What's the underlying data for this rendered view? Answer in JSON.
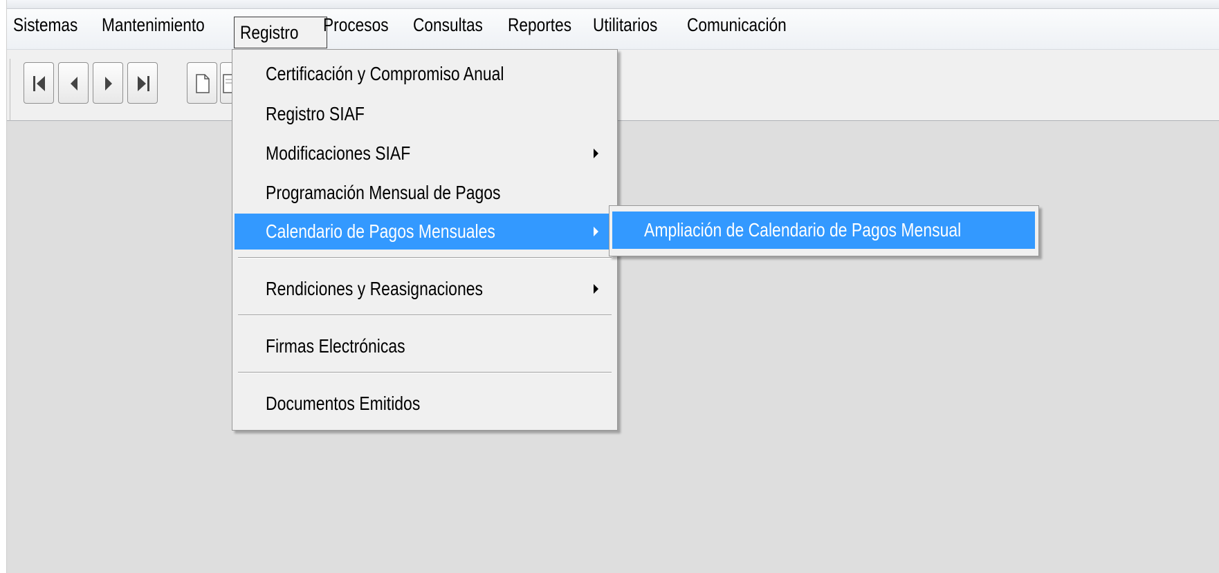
{
  "menubar": {
    "items": [
      {
        "label": "Sistemas"
      },
      {
        "label": "Mantenimiento"
      },
      {
        "label": "Registro"
      },
      {
        "label": "Procesos"
      },
      {
        "label": "Consultas"
      },
      {
        "label": "Reportes"
      },
      {
        "label": "Utilitarios"
      },
      {
        "label": "Comunicación"
      }
    ],
    "active": "Registro"
  },
  "toolbar": {
    "buttons": [
      {
        "icon": "first-record-icon"
      },
      {
        "icon": "previous-record-icon"
      },
      {
        "icon": "next-record-icon"
      },
      {
        "icon": "last-record-icon"
      },
      {
        "icon": "new-document-icon"
      },
      {
        "icon": "document-icon"
      }
    ]
  },
  "registro_menu": {
    "items": [
      {
        "label": "Certificación y Compromiso Anual",
        "submenu": false
      },
      {
        "label": "Registro SIAF",
        "submenu": false
      },
      {
        "label": "Modificaciones SIAF",
        "submenu": true
      },
      {
        "label": "Programación Mensual de Pagos",
        "submenu": false
      },
      {
        "label": "Calendario de Pagos Mensuales",
        "submenu": true,
        "highlighted": true
      },
      {
        "label": "Rendiciones y Reasignaciones",
        "submenu": true
      },
      {
        "label": "Firmas Electrónicas",
        "submenu": false
      },
      {
        "label": "Documentos Emitidos",
        "submenu": false
      }
    ]
  },
  "calendario_submenu": {
    "items": [
      {
        "label": "Ampliación de Calendario de Pagos Mensual",
        "highlighted": true
      }
    ]
  },
  "colors": {
    "highlight": "#3399ff",
    "menu_background": "#f0f0f0",
    "workspace": "#dedede"
  }
}
